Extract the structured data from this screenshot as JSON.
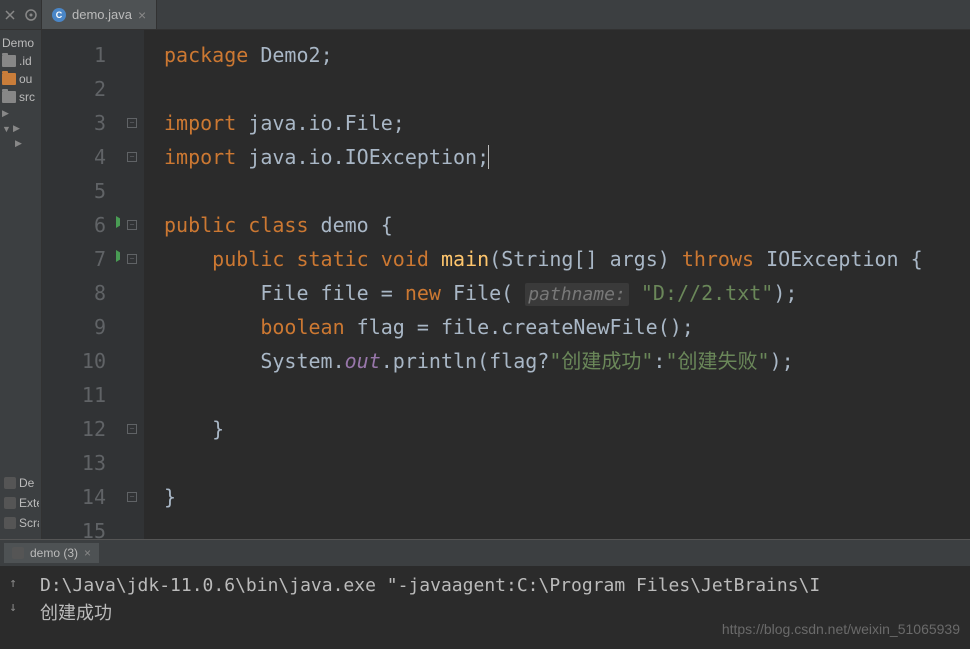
{
  "tab": {
    "filename": "demo.java"
  },
  "project": {
    "root": "Demo",
    "items": [
      {
        "label": ".id",
        "type": "folder"
      },
      {
        "label": "ou",
        "type": "folder-orange"
      },
      {
        "label": "src",
        "type": "folder"
      }
    ]
  },
  "side_panels": [
    {
      "label": "De"
    },
    {
      "label": "Extern"
    },
    {
      "label": "Scratc"
    }
  ],
  "code": {
    "lines": [
      {
        "n": 1,
        "indent": 0,
        "tokens": [
          [
            "kw",
            "package"
          ],
          [
            "",
            ""
          ],
          [
            "type",
            "Demo2"
          ],
          [
            "",
            ";"
          ]
        ]
      },
      {
        "n": 2,
        "indent": 0,
        "tokens": []
      },
      {
        "n": 3,
        "indent": 0,
        "fold": true,
        "tokens": [
          [
            "kw",
            "import"
          ],
          [
            "",
            ""
          ],
          [
            "type",
            "java.io.File"
          ],
          [
            "",
            ";"
          ]
        ]
      },
      {
        "n": 4,
        "indent": 0,
        "fold": true,
        "caret": true,
        "tokens": [
          [
            "kw",
            "import"
          ],
          [
            "",
            ""
          ],
          [
            "type",
            "java.io.IOException"
          ],
          [
            "",
            ";"
          ]
        ]
      },
      {
        "n": 5,
        "indent": 0,
        "tokens": []
      },
      {
        "n": 6,
        "indent": 0,
        "run": true,
        "fold": true,
        "tokens": [
          [
            "kw",
            "public class"
          ],
          [
            "",
            ""
          ],
          [
            "type",
            "demo"
          ],
          [
            "",
            ""
          ],
          [
            "",
            "{"
          ]
        ]
      },
      {
        "n": 7,
        "indent": 1,
        "run": true,
        "fold": true,
        "tokens": [
          [
            "kw",
            "public static"
          ],
          [
            "",
            ""
          ],
          [
            "kw",
            "void"
          ],
          [
            "",
            ""
          ],
          [
            "method",
            "main"
          ],
          [
            "",
            "(String[] args) "
          ],
          [
            "kw",
            "throws"
          ],
          [
            "",
            ""
          ],
          [
            "type",
            "IOException"
          ],
          [
            "",
            ""
          ],
          [
            "",
            "{"
          ]
        ]
      },
      {
        "n": 8,
        "indent": 2,
        "tokens": [
          [
            "type",
            "File file"
          ],
          [
            "",
            ""
          ],
          [
            "",
            "= "
          ],
          [
            "kw",
            "new"
          ],
          [
            "",
            ""
          ],
          [
            "type",
            "File"
          ],
          [
            "",
            "( "
          ],
          [
            "hint",
            "pathname:"
          ],
          [
            "",
            ""
          ],
          [
            "str",
            "\"D://2.txt\""
          ],
          [
            "",
            ");"
          ]
        ]
      },
      {
        "n": 9,
        "indent": 2,
        "tokens": [
          [
            "kw",
            "boolean"
          ],
          [
            "",
            ""
          ],
          [
            "type",
            "flag"
          ],
          [
            "",
            ""
          ],
          [
            "",
            "= file.createNewFile();"
          ]
        ]
      },
      {
        "n": 10,
        "indent": 2,
        "tokens": [
          [
            "type",
            "System."
          ],
          [
            "field",
            "out"
          ],
          [
            "",
            ".println(flag?"
          ],
          [
            "str",
            "\"创建成功\""
          ],
          [
            "",
            ":"
          ],
          [
            "str",
            "\"创建失败\""
          ],
          [
            "",
            ");"
          ]
        ]
      },
      {
        "n": 11,
        "indent": 2,
        "tokens": []
      },
      {
        "n": 12,
        "indent": 1,
        "fold": true,
        "tokens": [
          [
            "",
            "}"
          ]
        ]
      },
      {
        "n": 13,
        "indent": 0,
        "tokens": []
      },
      {
        "n": 14,
        "indent": 0,
        "fold": true,
        "tokens": [
          [
            "",
            "}"
          ]
        ]
      },
      {
        "n": 15,
        "indent": 0,
        "tokens": []
      }
    ]
  },
  "console": {
    "tab_label": "demo (3)",
    "line1": "D:\\Java\\jdk-11.0.6\\bin\\java.exe \"-javaagent:C:\\Program Files\\JetBrains\\I",
    "line2": "创建成功"
  },
  "watermark": "https://blog.csdn.net/weixin_51065939"
}
